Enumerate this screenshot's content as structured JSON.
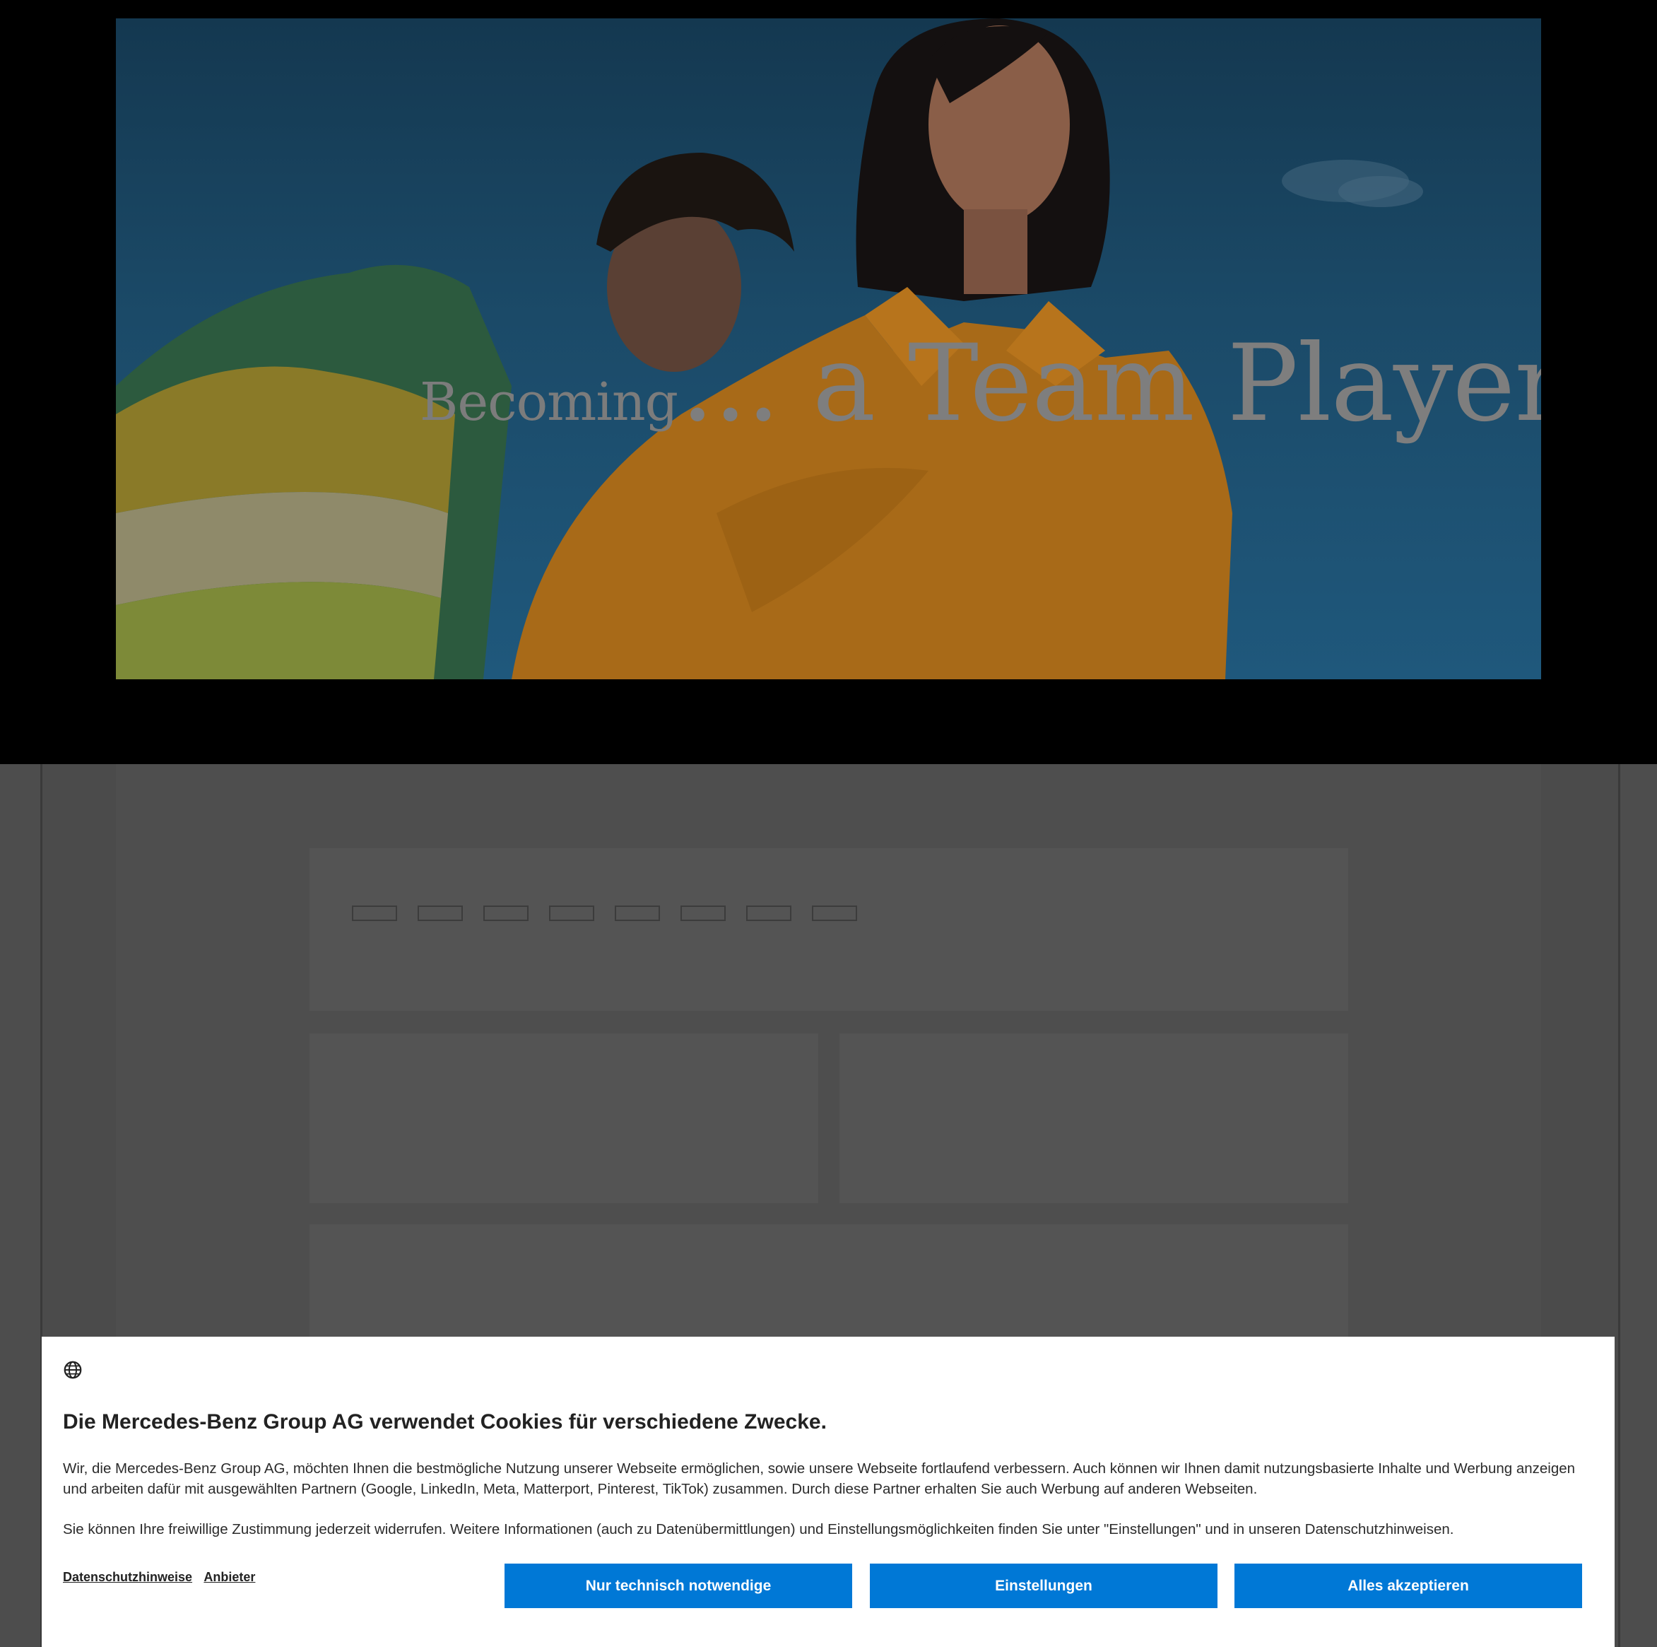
{
  "hero": {
    "title_part1": "Becoming",
    "title_part2": "... a Team Player"
  },
  "nav_tabs": [
    "",
    "",
    "",
    "",
    "",
    "",
    "",
    ""
  ],
  "cookie_banner": {
    "icon": "globe-icon",
    "title": "Die Mercedes-Benz Group AG verwendet Cookies für verschiedene Zwecke.",
    "paragraph1": "Wir, die Mercedes-Benz Group AG, möchten Ihnen die bestmögliche Nutzung unserer Webseite ermöglichen, sowie unsere Webseite fortlaufend verbessern. Auch können wir Ihnen damit nutzungsbasierte Inhalte und Werbung anzeigen und arbeiten dafür mit ausgewählten Partnern (Google, LinkedIn, Meta, Matterport, Pinterest, TikTok) zusammen. Durch diese Partner erhalten Sie auch Werbung auf anderen Webseiten.",
    "paragraph2": "Sie können Ihre freiwillige Zustimmung jederzeit widerrufen. Weitere Informationen (auch zu Datenübermittlungen) und Einstellungsmöglichkeiten finden Sie unter \"Einstellungen\" und in unseren Datenschutzhinweisen.",
    "link_privacy": "Datenschutzhinweise",
    "link_providers": "Anbieter",
    "btn_necessary": "Nur technisch notwendige",
    "btn_settings": "Einstellungen",
    "btn_accept": "Alles akzeptieren",
    "button_color": "#0078d6"
  }
}
